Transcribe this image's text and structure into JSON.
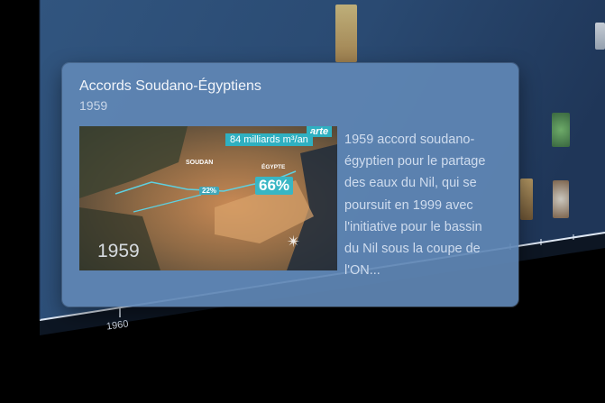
{
  "timeline": {
    "year_label": "1960"
  },
  "card": {
    "title": "Accords Soudano-Égyptiens",
    "date": "1959",
    "description": "1959  accord soudano-égyptien pour le partage des eaux du Nil, qui se poursuit en 1999 avec l'initiative pour le bassin du Nil sous la coupe de l'ON..."
  },
  "media": {
    "icon": "map-thumbnail",
    "label_sudan": "SOUDAN",
    "label_egypt": "ÉGYPTE",
    "pct_sudan": "22%",
    "pct_egypt": "66%",
    "flow": "84 milliards m³/an",
    "brand": "arte",
    "year": "1959",
    "compass": "✴"
  },
  "colors": {
    "card_bg": "#6086b5",
    "wall": "#2b4a72",
    "accent": "#38b6c4"
  }
}
